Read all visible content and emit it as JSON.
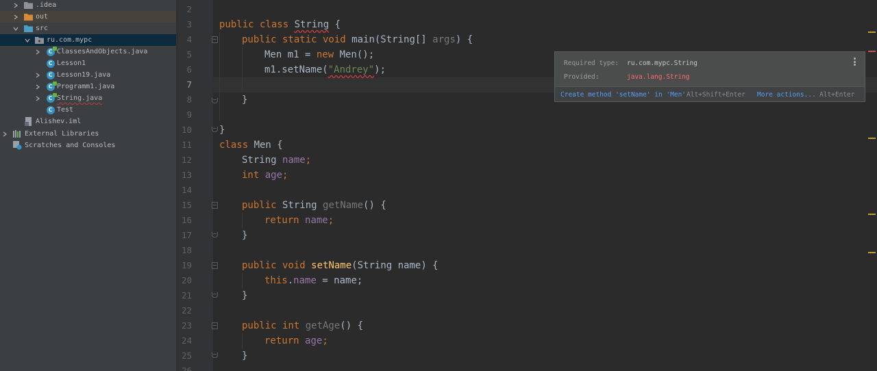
{
  "project_tree": {
    "items": [
      {
        "label": ".idea",
        "icon": "folder-icon"
      },
      {
        "label": "out",
        "icon": "folder-excluded-icon"
      },
      {
        "label": "src",
        "icon": "source-folder-icon"
      },
      {
        "label": "ru.com.mypc",
        "icon": "package-icon"
      },
      {
        "label": "ClassesAndObjects.java",
        "icon": "java-class-icon"
      },
      {
        "label": "Lesson1",
        "icon": "java-class-icon"
      },
      {
        "label": "Lesson19.java",
        "icon": "java-class-icon"
      },
      {
        "label": "Programm1.java",
        "icon": "java-class-icon"
      },
      {
        "label": "String.java",
        "icon": "java-class-icon"
      },
      {
        "label": "Test",
        "icon": "java-class-icon"
      },
      {
        "label": "Alishev.iml",
        "icon": "module-file-icon"
      },
      {
        "label": "External Libraries",
        "icon": "libraries-icon"
      },
      {
        "label": "Scratches and Consoles",
        "icon": "scratches-icon"
      }
    ]
  },
  "editor": {
    "line_numbers": [
      "2",
      "3",
      "4",
      "5",
      "6",
      "7",
      "8",
      "9",
      "10",
      "11",
      "12",
      "13",
      "14",
      "15",
      "16",
      "17",
      "18",
      "19",
      "20",
      "21",
      "22",
      "23",
      "24",
      "25",
      "26"
    ],
    "current_line": "7",
    "code": {
      "l3": {
        "a": "public class ",
        "b": "String",
        "c": " {"
      },
      "l4": {
        "a": "public static void ",
        "b": "main",
        "c": "(String[] ",
        "d": "args",
        "e": ") {"
      },
      "l5": {
        "a": "Men m1 = ",
        "b": "new ",
        "c": "Men();"
      },
      "l6": {
        "a": "m1.setName(",
        "b": "\"Andrey\"",
        "c": ");"
      },
      "l8": "}",
      "l10": "}",
      "l11": {
        "a": "class ",
        "b": "Men {"
      },
      "l12": {
        "a": "String ",
        "b": "name",
        "c": ";"
      },
      "l13": {
        "a": "int ",
        "b": "age",
        "c": ";"
      },
      "l15": {
        "a": "public ",
        "b": "String ",
        "c": "getName",
        "d": "() {"
      },
      "l16": {
        "a": "return ",
        "b": "name",
        "c": ";"
      },
      "l17": "}",
      "l19": {
        "a": "public void ",
        "b": "setName",
        "c": "(String name) {"
      },
      "l20": {
        "a": "this",
        "b": ".",
        "c": "name",
        "d": " = name;"
      },
      "l21": "}",
      "l23": {
        "a": "public int ",
        "b": "getAge",
        "c": "() {"
      },
      "l24": {
        "a": "return ",
        "b": "age",
        "c": ";"
      },
      "l25": "}"
    }
  },
  "tooltip": {
    "required_label": "Required type:",
    "required_value": "ru.com.mypc.String",
    "provided_label": "Provided:",
    "provided_value": "java.lang.String",
    "action_label": "Create method 'setName' in 'Men'",
    "action_shortcut": "Alt+Shift+Enter",
    "more_label": "More actions...",
    "more_shortcut": "Alt+Enter"
  },
  "colors": {
    "keyword": "#cc7832",
    "field": "#9876aa",
    "string": "#6a8759",
    "method": "#ffc66d",
    "error": "#ff6b68",
    "link": "#589df6"
  }
}
